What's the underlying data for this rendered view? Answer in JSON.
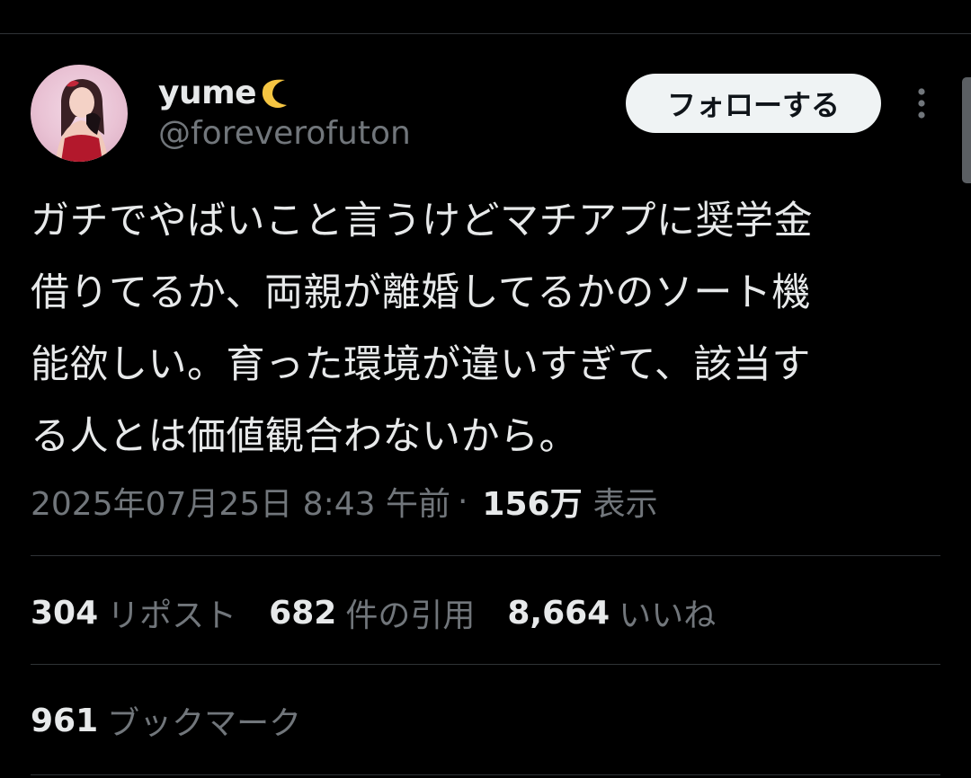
{
  "user": {
    "display_name": "yume",
    "name_emoji": "crescent-moon-icon",
    "handle": "@foreverofuton",
    "follow_label": "フォローする"
  },
  "tweet": {
    "text": "ガチでやばいこと言うけどマチアプに奨学金\n借りてるか、両親が離婚してるかのソート機\n能欲しい。育った環境が違いすぎて、該当す\nる人とは価値観合わないから。"
  },
  "meta": {
    "timestamp": "2025年07月25日 8:43 午前",
    "separator": "·",
    "views_count": "156万",
    "views_label": "表示"
  },
  "stats": {
    "reposts": {
      "count": "304",
      "label": "リポスト"
    },
    "quotes": {
      "count": "682",
      "label": "件の引用"
    },
    "likes": {
      "count": "8,664",
      "label": "いいね"
    },
    "bookmarks": {
      "count": "961",
      "label": "ブックマーク"
    }
  },
  "colors": {
    "background": "#000000",
    "primary_text": "#e7e9ea",
    "secondary_text": "#71767b",
    "divider": "#2f3336",
    "moon": "#f5c542"
  }
}
